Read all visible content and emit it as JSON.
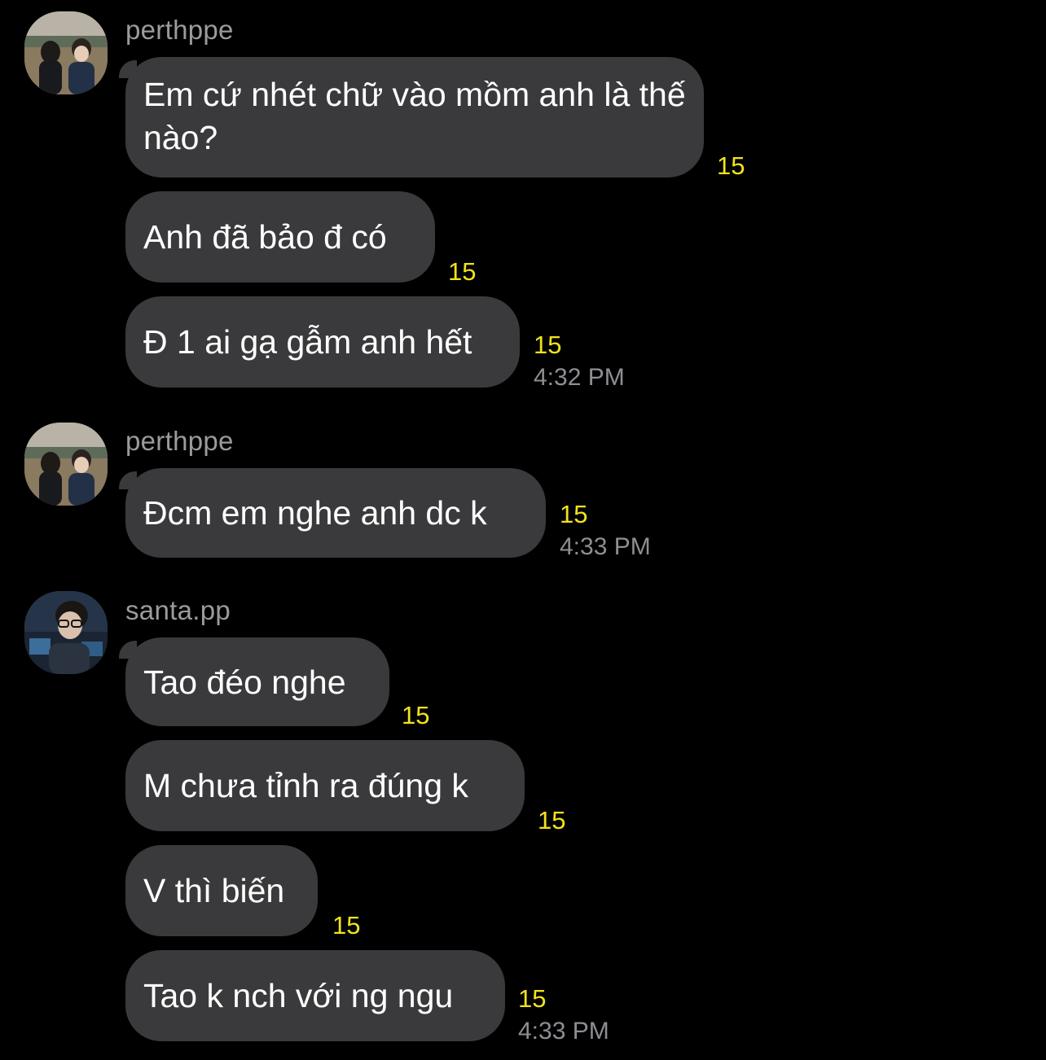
{
  "conversation": {
    "groups": [
      {
        "sender": "perthppe",
        "avatar_icon": "profile-photo-couple",
        "messages": [
          {
            "text": "Em cứ nhét chữ vào mồm anh là thế nào?",
            "count": "15"
          },
          {
            "text": "Anh đã bảo đ có",
            "count": "15"
          },
          {
            "text": "Đ 1 ai gạ gẫm anh hết",
            "count": "15",
            "time": "4:32 PM"
          }
        ]
      },
      {
        "sender": "perthppe",
        "avatar_icon": "profile-photo-couple",
        "messages": [
          {
            "text": "Đcm em nghe anh dc k",
            "count": "15",
            "time": "4:33 PM"
          }
        ]
      },
      {
        "sender": "santa.pp",
        "avatar_icon": "profile-photo-glasses",
        "messages": [
          {
            "text": "Tao đéo nghe",
            "count": "15"
          },
          {
            "text": "M chưa tỉnh ra đúng k",
            "count": "15"
          },
          {
            "text": "V thì biến",
            "count": "15"
          },
          {
            "text": "Tao k nch với ng ngu",
            "count": "15",
            "time": "4:33 PM"
          }
        ]
      }
    ]
  },
  "colors": {
    "background": "#000000",
    "bubble": "#3a3a3c",
    "count": "#f2e21c",
    "sender": "#9b9b9b",
    "time": "#8e8e93"
  }
}
